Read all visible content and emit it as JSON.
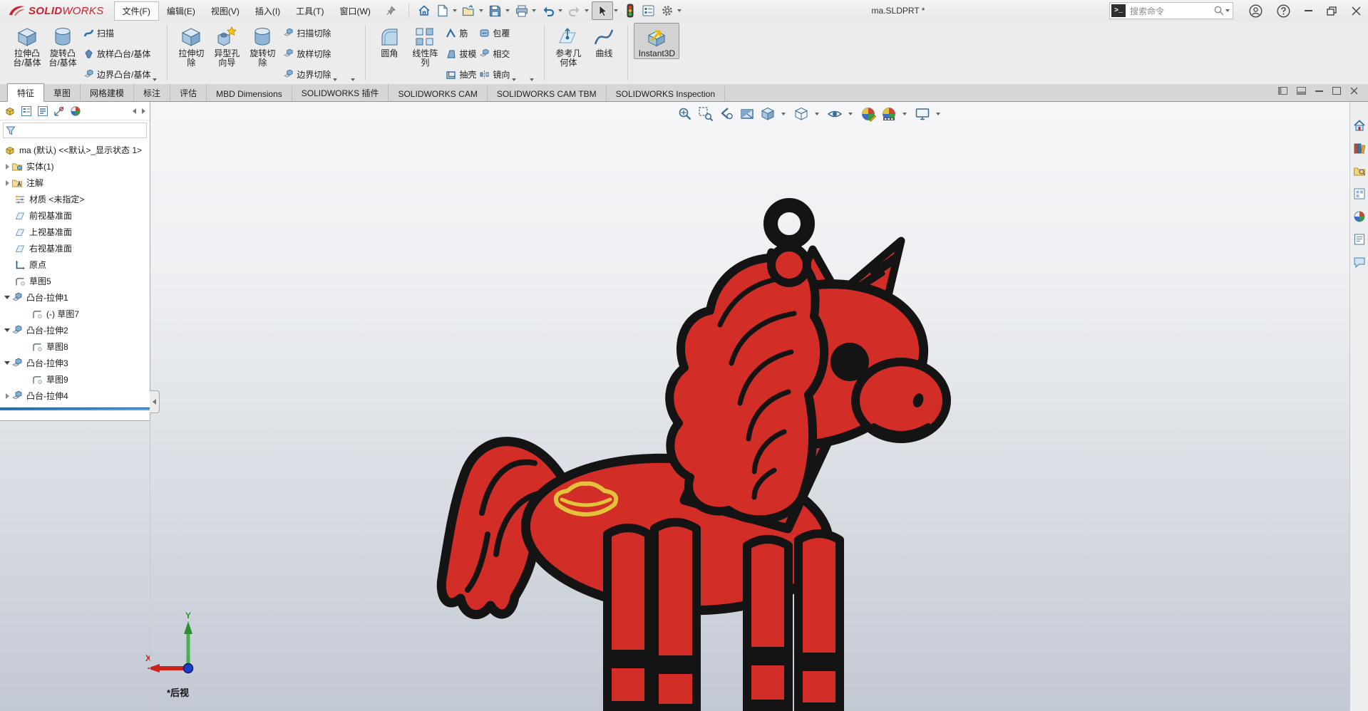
{
  "titlebar": {
    "logo_solid": "SOLID",
    "logo_works": "WORKS",
    "menus": [
      "文件(F)",
      "编辑(E)",
      "视图(V)",
      "插入(I)",
      "工具(T)",
      "窗口(W)"
    ],
    "document_title": "ma.SLDPRT *",
    "search_prompt_glyph": ">_",
    "search_placeholder": "搜索命令",
    "quickbar_icons": [
      "home-icon",
      "new-document-icon",
      "open-icon",
      "save-icon",
      "print-icon",
      "undo-icon",
      "redo-icon",
      "select-cursor-icon",
      "performance-icon",
      "options-list-icon",
      "settings-gear-icon"
    ],
    "window_icons": [
      "account-icon",
      "help-icon",
      "minimize-icon",
      "restore-icon",
      "close-icon"
    ]
  },
  "ribbon": {
    "groups": [
      {
        "large": [
          {
            "line1": "拉伸凸",
            "line2": "台/基体"
          },
          {
            "line1": "旋转凸",
            "line2": "台/基体"
          }
        ],
        "small": [
          "扫描",
          "放样凸台/基体",
          "边界凸台/基体"
        ]
      },
      {
        "large": [
          {
            "line1": "拉伸切",
            "line2": "除"
          },
          {
            "line1": "异型孔",
            "line2": "向导"
          },
          {
            "line1": "旋转切",
            "line2": "除"
          }
        ],
        "small": [
          "扫描切除",
          "放样切除",
          "边界切除"
        ]
      },
      {
        "large": [
          {
            "line1": "圆角",
            "line2": ""
          },
          {
            "line1": "线性阵",
            "line2": "列"
          }
        ],
        "small": [
          "筋",
          "拔模",
          "抽壳"
        ],
        "small2": [
          "包覆",
          "相交",
          "镜向"
        ]
      },
      {
        "large": [
          {
            "line1": "参考几",
            "line2": "何体"
          },
          {
            "line1": "曲线",
            "line2": ""
          }
        ]
      },
      {
        "large": [
          {
            "line1": "Instant3D",
            "line2": ""
          }
        ],
        "active": true
      }
    ]
  },
  "tabbar": {
    "tabs": [
      "特征",
      "草图",
      "网格建模",
      "标注",
      "评估",
      "MBD Dimensions",
      "SOLIDWORKS 插件",
      "SOLIDWORKS CAM",
      "SOLIDWORKS CAM TBM",
      "SOLIDWORKS Inspection"
    ],
    "active_index": 0
  },
  "feature_tree": {
    "items": [
      {
        "label": "ma (默认) <<默认>_显示状态 1>",
        "icon": "part-icon",
        "expander": "none",
        "indent": 0
      },
      {
        "label": "实体(1)",
        "icon": "solid-bodies-folder-icon",
        "expander": "collapsed",
        "indent": 1
      },
      {
        "label": "注解",
        "icon": "annotations-folder-icon",
        "expander": "collapsed",
        "indent": 1
      },
      {
        "label": "材质 <未指定>",
        "icon": "material-icon",
        "expander": "none",
        "indent": 1
      },
      {
        "label": "前视基准面",
        "icon": "plane-icon",
        "expander": "none",
        "indent": 1
      },
      {
        "label": "上视基准面",
        "icon": "plane-icon",
        "expander": "none",
        "indent": 1
      },
      {
        "label": "右视基准面",
        "icon": "plane-icon",
        "expander": "none",
        "indent": 1
      },
      {
        "label": "原点",
        "icon": "origin-icon",
        "expander": "none",
        "indent": 1
      },
      {
        "label": "草图5",
        "icon": "sketch-icon",
        "expander": "none",
        "indent": 1
      },
      {
        "label": "凸台-拉伸1",
        "icon": "boss-extrude-icon",
        "expander": "expanded",
        "indent": 1
      },
      {
        "label": "(-) 草图7",
        "icon": "sketch-icon",
        "expander": "none",
        "indent": 2
      },
      {
        "label": "凸台-拉伸2",
        "icon": "boss-extrude-icon",
        "expander": "expanded",
        "indent": 1
      },
      {
        "label": "草图8",
        "icon": "sketch-icon",
        "expander": "none",
        "indent": 2
      },
      {
        "label": "凸台-拉伸3",
        "icon": "boss-extrude-icon",
        "expander": "expanded",
        "indent": 1
      },
      {
        "label": "草图9",
        "icon": "sketch-icon",
        "expander": "none",
        "indent": 2
      },
      {
        "label": "凸台-拉伸4",
        "icon": "boss-extrude-icon",
        "expander": "collapsed",
        "indent": 1
      }
    ]
  },
  "headsup": {
    "icons": [
      "zoom-fit-icon",
      "zoom-area-icon",
      "previous-view-icon",
      "section-view-icon",
      "view-orientation-icon",
      "display-style-icon",
      "hide-show-items-icon",
      "edit-appearance-icon",
      "apply-scene-icon",
      "view-settings-icon"
    ]
  },
  "taskpane": {
    "icons": [
      "resources-icon",
      "design-library-icon",
      "file-explorer-icon",
      "view-palette-icon",
      "appearances-icon",
      "custom-properties-icon",
      "forum-icon"
    ]
  },
  "viewport": {
    "view_label": "*后视",
    "triad_x": "X",
    "triad_y": "Y"
  },
  "model_colors": {
    "body": "#d22d27",
    "outline": "#141414",
    "emblem": "#e3c23c"
  },
  "accent_colors": {
    "rollback_bar": "#1f74c0",
    "logo_red": "#cf202f"
  }
}
